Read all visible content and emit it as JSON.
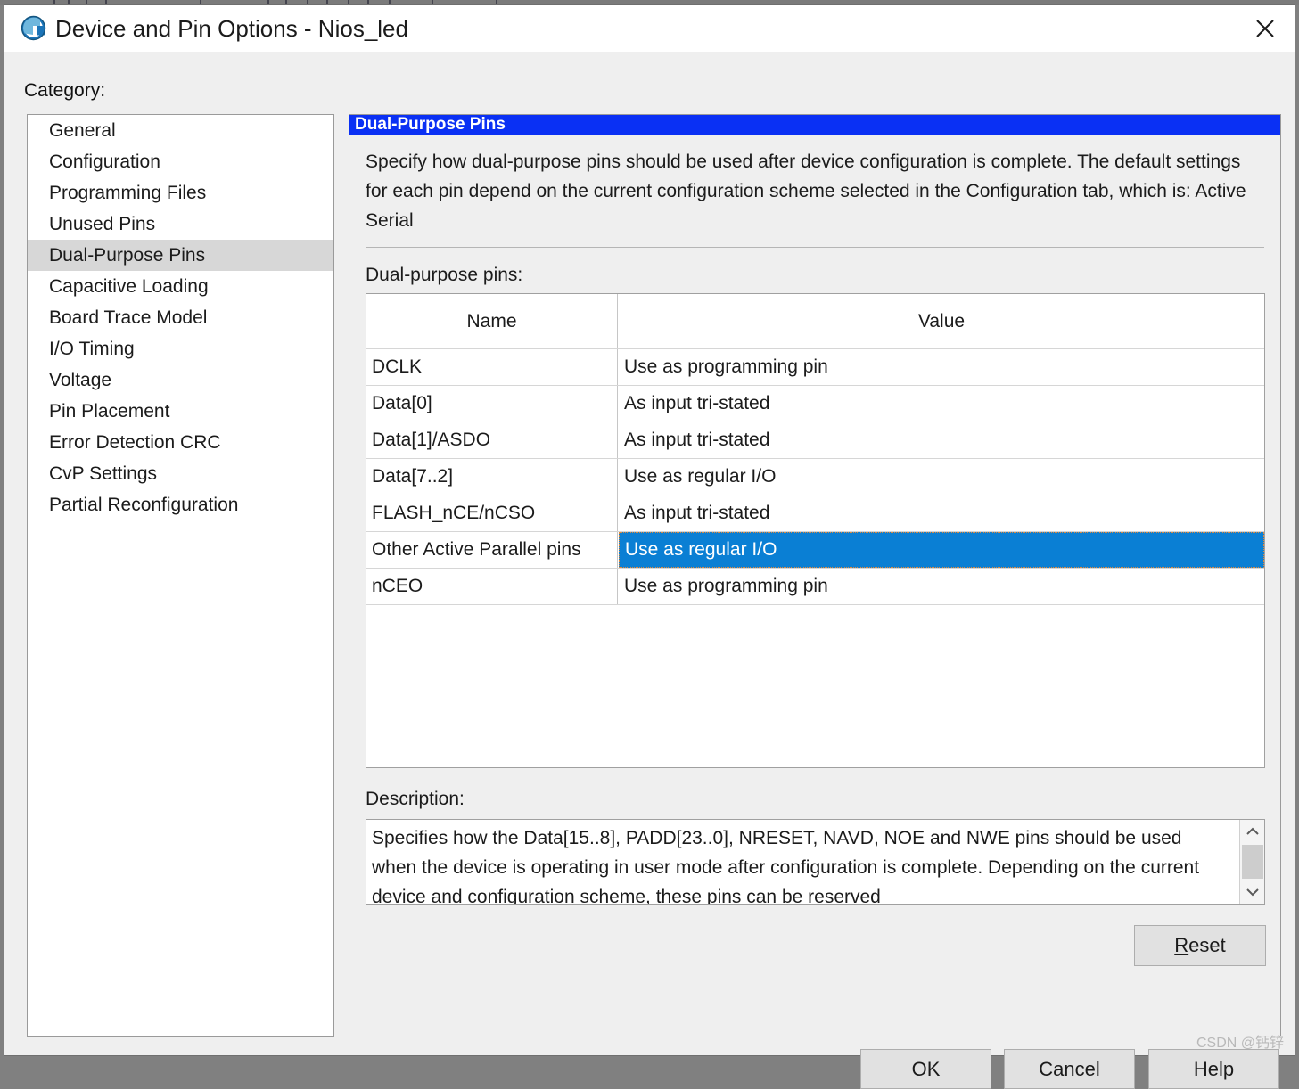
{
  "window": {
    "title": "Device and Pin Options - Nios_led",
    "app_icon": "quartus-globe-icon",
    "close_icon": "close-icon"
  },
  "category": {
    "label": "Category:",
    "items": [
      "General",
      "Configuration",
      "Programming Files",
      "Unused Pins",
      "Dual-Purpose Pins",
      "Capacitive Loading",
      "Board Trace Model",
      "I/O Timing",
      "Voltage",
      "Pin Placement",
      "Error Detection CRC",
      "CvP Settings",
      "Partial Reconfiguration"
    ],
    "selected_index": 4
  },
  "panel": {
    "header": "Dual-Purpose Pins",
    "intro": "Specify how dual-purpose pins should be used after device configuration is complete. The default settings for each pin depend on the current configuration scheme selected in the Configuration tab, which is:  Active Serial",
    "table_label": "Dual-purpose pins:",
    "columns": [
      "Name",
      "Value"
    ],
    "rows": [
      {
        "name": "DCLK",
        "value": "Use as programming pin",
        "selected": false
      },
      {
        "name": "Data[0]",
        "value": "As input tri-stated",
        "selected": false
      },
      {
        "name": "Data[1]/ASDO",
        "value": "As input tri-stated",
        "selected": false
      },
      {
        "name": "Data[7..2]",
        "value": "Use as regular I/O",
        "selected": false
      },
      {
        "name": "FLASH_nCE/nCSO",
        "value": "As input tri-stated",
        "selected": false
      },
      {
        "name": "Other Active Parallel pins",
        "value": "Use as regular I/O",
        "selected": true
      },
      {
        "name": "nCEO",
        "value": "Use as programming pin",
        "selected": false
      }
    ],
    "description_label": "Description:",
    "description": "Specifies how the Data[15..8], PADD[23..0], NRESET, NAVD, NOE and NWE pins should be used when the device is operating in user mode after configuration is complete. Depending on the current device and configuration scheme, these pins can be reserved",
    "scrollbar": {
      "up_icon": "chevron-up-icon",
      "down_icon": "chevron-down-icon"
    },
    "reset_label_prefix": "R",
    "reset_label_rest": "eset"
  },
  "buttons": {
    "ok": "OK",
    "cancel": "Cancel",
    "help": "Help"
  },
  "watermark": "CSDN @钙锌",
  "colors": {
    "panel_header_blue": "#0a30f4",
    "selection_blue": "#0a7fd4",
    "dialog_background": "#efefef",
    "list_selected_gray": "#d7d7d7"
  }
}
